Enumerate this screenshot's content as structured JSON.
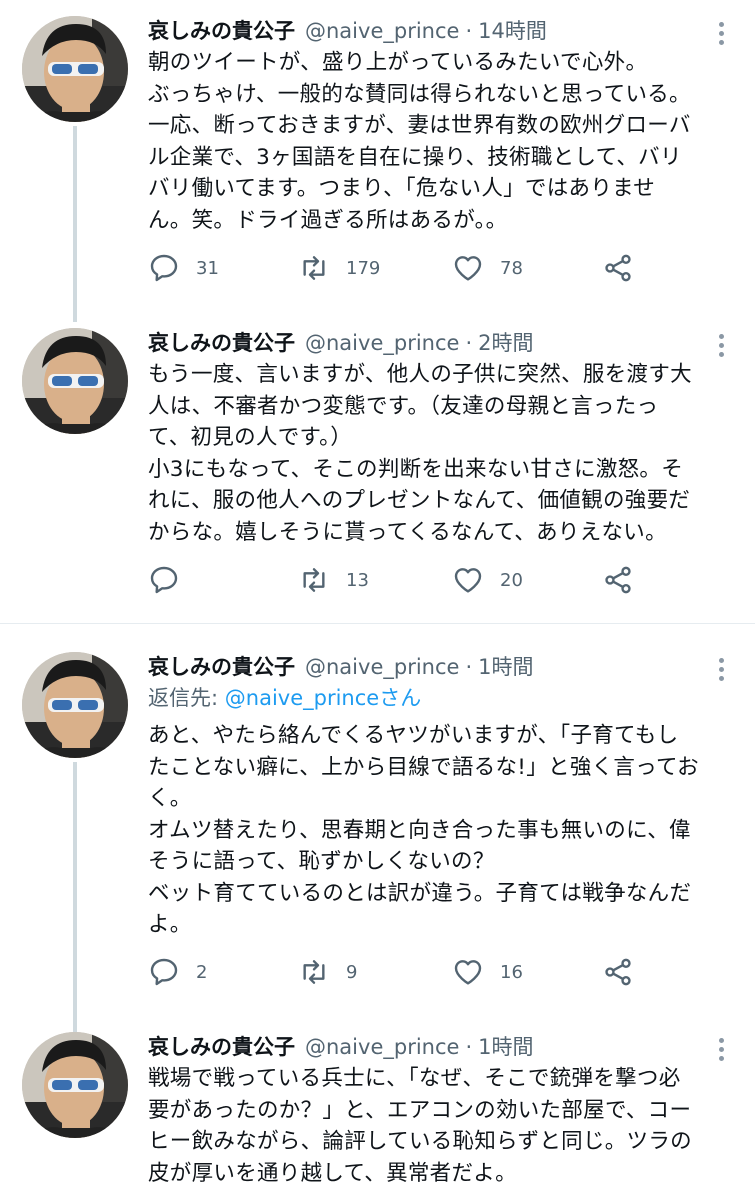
{
  "tweets": [
    {
      "name": "哀しみの貴公子",
      "handle": "@naive_prince",
      "sep": "·",
      "time": "14時間",
      "reply_prefix": "",
      "reply_handle": "",
      "reply_suffix": "",
      "text": "朝のツイートが、盛り上がっているみたいで心外。\nぶっちゃけ、一般的な賛同は得られないと思っている。\n一応、断っておきますが、妻は世界有数の欧州グローバ\nル企業で、3ヶ国語を自在に操り、技術職として、バリ\nバリ働いてます。つまり、「危ない人」ではありませ\nん。笑。ドライ過ぎる所はあるが。。",
      "replies": "31",
      "retweets": "179",
      "likes": "78"
    },
    {
      "name": "哀しみの貴公子",
      "handle": "@naive_prince",
      "sep": "·",
      "time": "2時間",
      "reply_prefix": "",
      "reply_handle": "",
      "reply_suffix": "",
      "text": "もう一度、言いますが、他人の子供に突然、服を渡す大\n人は、不審者かつ変態です。（友達の母親と言ったっ\nて、初見の人です。）\n小3にもなって、そこの判断を出来ない甘さに激怒。そ\nれに、服の他人へのプレゼントなんて、価値観の強要だ\nからな。嬉しそうに貰ってくるなんて、ありえない。",
      "replies": "",
      "retweets": "13",
      "likes": "20"
    },
    {
      "name": "哀しみの貴公子",
      "handle": "@naive_prince",
      "sep": "·",
      "time": "1時間",
      "reply_prefix": "返信先: ",
      "reply_handle": "@naive_prince",
      "reply_suffix": "さん",
      "text": "あと、やたら絡んでくるヤツがいますが、「子育てもし\nたことない癖に、上から目線で語るな!」と強く言ってお\nく。\nオムツ替えたり、思春期と向き合った事も無いのに、偉\nそうに語って、恥ずかしくないの？\nベット育てているのとは訳が違う。子育ては戦争なんだ\nよ。",
      "replies": "2",
      "retweets": "9",
      "likes": "16"
    },
    {
      "name": "哀しみの貴公子",
      "handle": "@naive_prince",
      "sep": "·",
      "time": "1時間",
      "reply_prefix": "",
      "reply_handle": "",
      "reply_suffix": "",
      "text": "戦場で戦っている兵士に、「なぜ、そこで銃弾を撃つ必\n要があったのか？」と、エアコンの効いた部屋で、コー\nヒー飲みながら、論評している恥知らずと同じ。ツラの\n皮が厚いを通り越して、異常者だよ。",
      "replies": "",
      "retweets": "",
      "likes": ""
    }
  ],
  "colors": {
    "text": "#0f1419",
    "secondary": "#536471",
    "link": "#1d9bf0",
    "thread_line": "#cfd9de"
  },
  "icons": [
    "reply-icon",
    "retweet-icon",
    "like-icon",
    "share-icon",
    "more-icon"
  ]
}
